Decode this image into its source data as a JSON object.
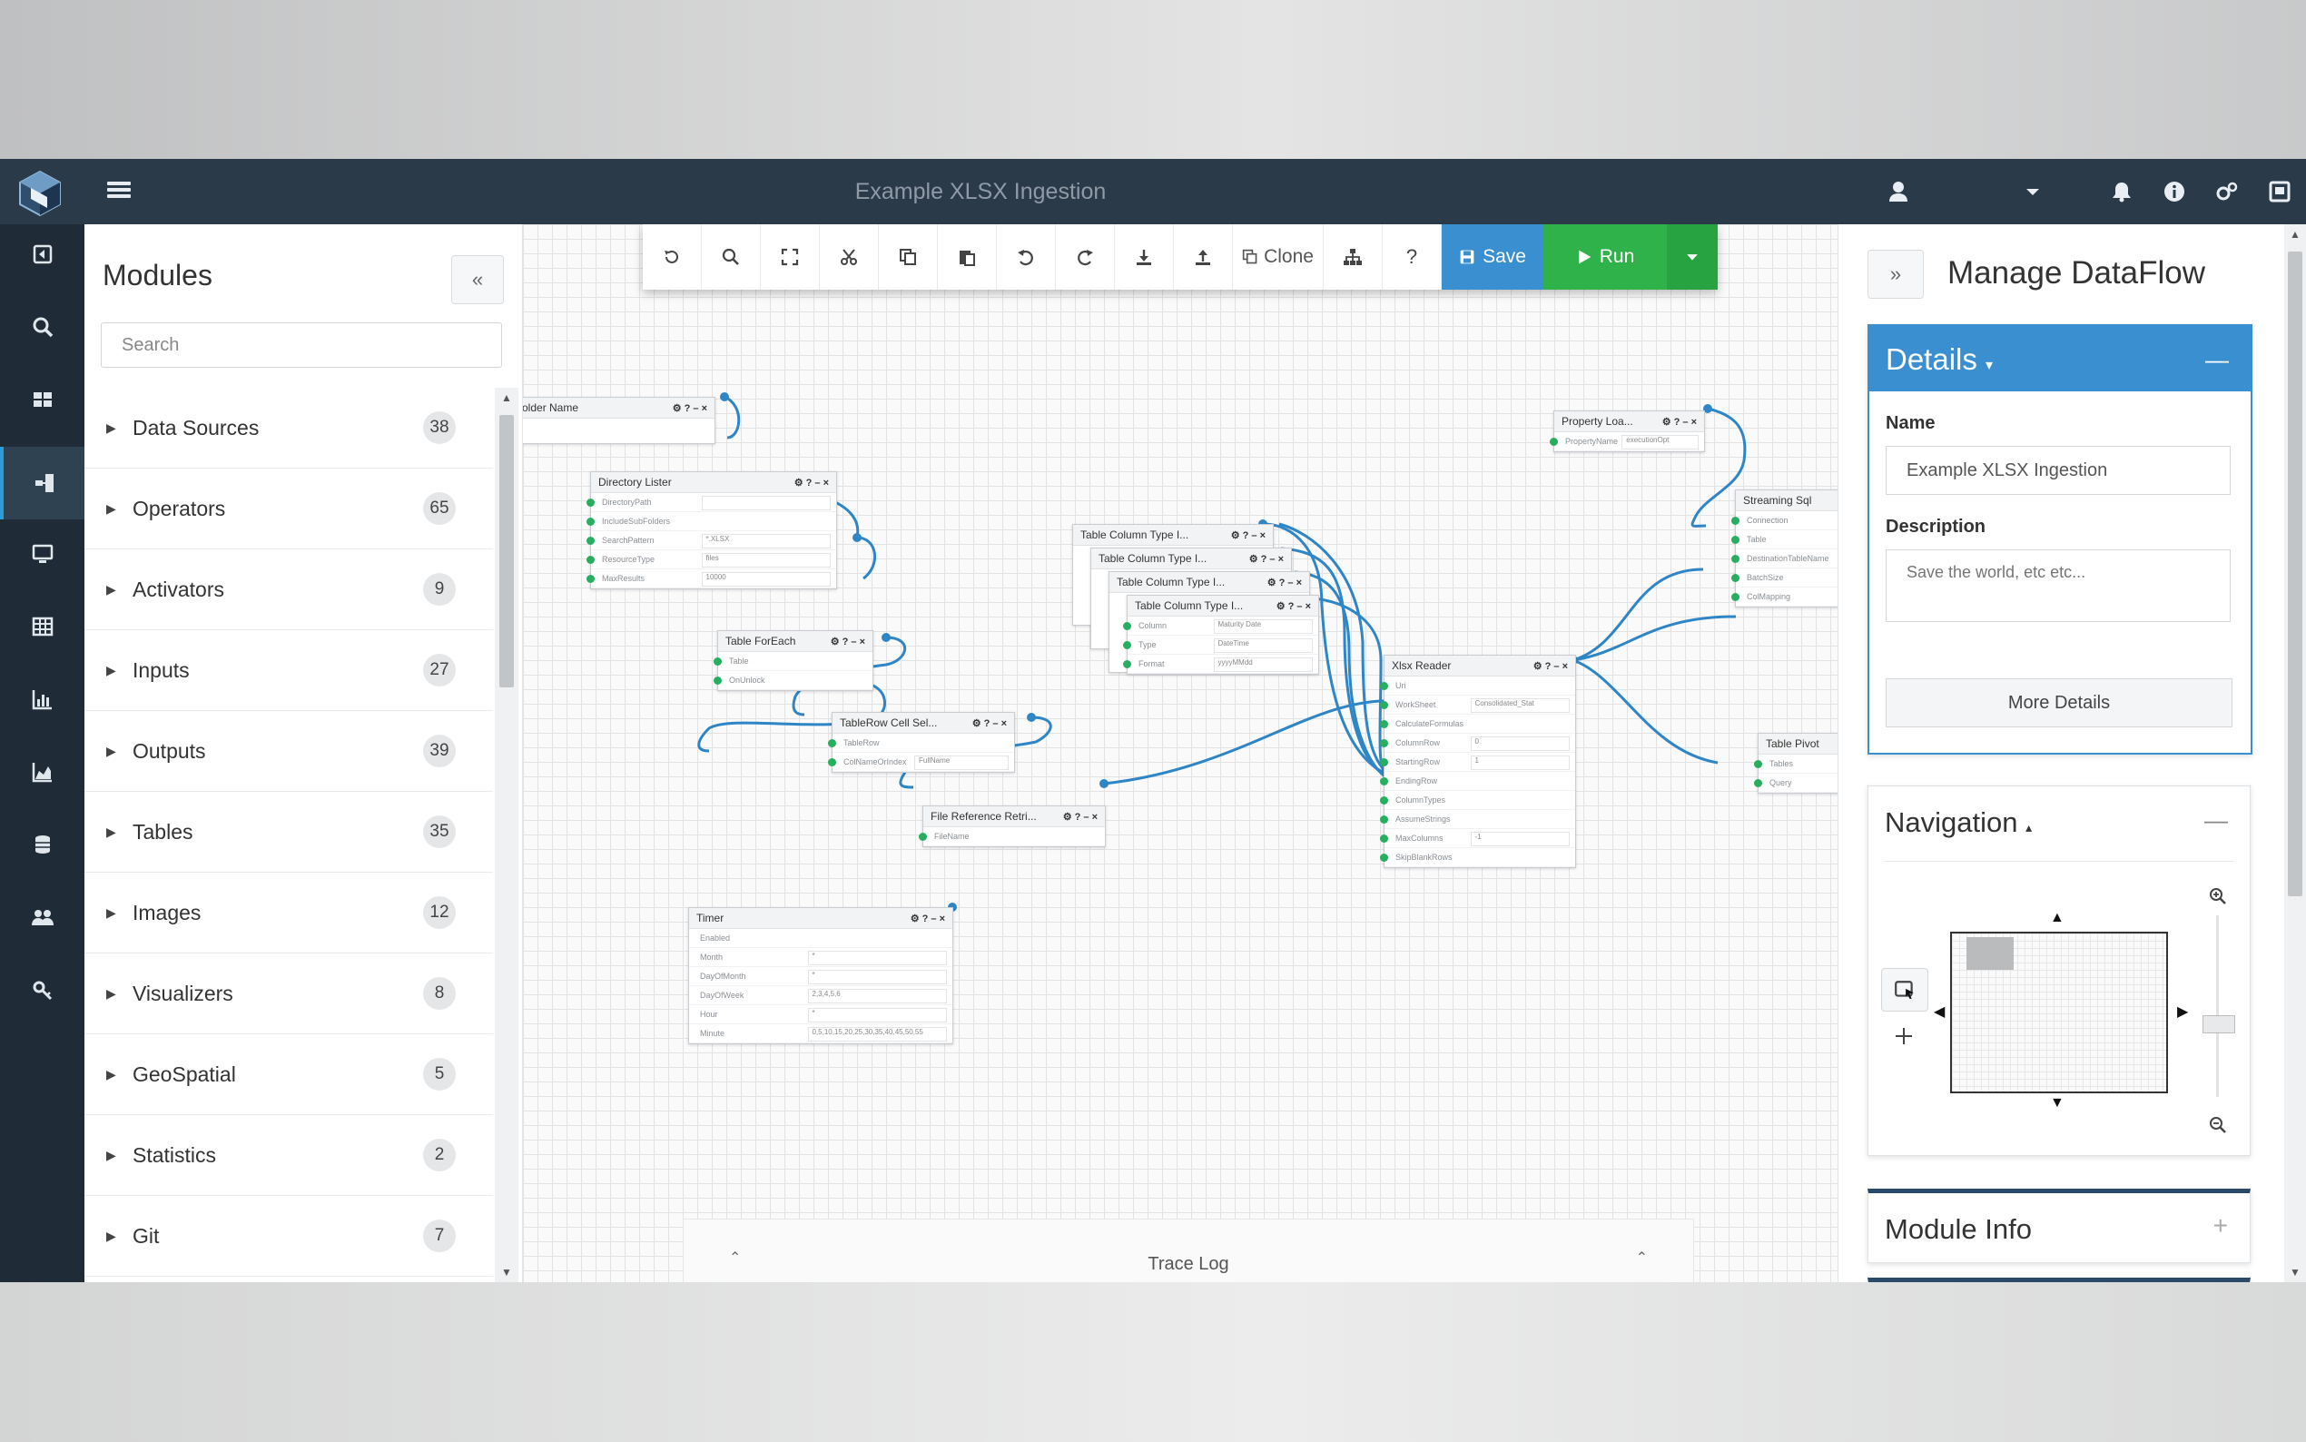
{
  "app": {
    "title": "Example XLSX Ingestion",
    "accent": "#3a8fd1",
    "navbar_color": "#2b3a48",
    "run_color": "#2fb24a"
  },
  "navbar": {
    "icons": [
      "user-icon",
      "caret-down-icon",
      "bell-icon",
      "info-icon",
      "settings-icon",
      "fullscreen-icon"
    ]
  },
  "rail": {
    "items": [
      "import-icon",
      "search-icon",
      "dashboard-icon",
      "dataflow-icon",
      "monitor-icon",
      "grid-icon",
      "bar-chart-icon",
      "area-chart-icon",
      "database-icon",
      "users-icon",
      "key-icon"
    ],
    "active": "dataflow-icon"
  },
  "modules": {
    "title": "Modules",
    "collapse": "«",
    "search_placeholder": "Search",
    "items": [
      {
        "label": "Data Sources",
        "count": "38"
      },
      {
        "label": "Operators",
        "count": "65"
      },
      {
        "label": "Activators",
        "count": "9"
      },
      {
        "label": "Inputs",
        "count": "27"
      },
      {
        "label": "Outputs",
        "count": "39"
      },
      {
        "label": "Tables",
        "count": "35"
      },
      {
        "label": "Images",
        "count": "12"
      },
      {
        "label": "Visualizers",
        "count": "8"
      },
      {
        "label": "GeoSpatial",
        "count": "5"
      },
      {
        "label": "Statistics",
        "count": "2"
      },
      {
        "label": "Git",
        "count": "7"
      }
    ]
  },
  "toolbar": {
    "clone": "Clone",
    "help": "?",
    "save": "Save",
    "run": "Run"
  },
  "canvas": {
    "nodes": {
      "folder": {
        "title": "older Name",
        "ctl": "⚙ ? – ×"
      },
      "dirlister": {
        "title": "Directory Lister",
        "ctl": "⚙ ? – ×",
        "rows": [
          "DirectoryPath",
          "IncludeSubFolders",
          "SearchPattern",
          "ResourceType",
          "MaxResults"
        ],
        "values": [
          "",
          "",
          "*.XLSX",
          "files",
          "10000"
        ]
      },
      "foreach": {
        "title": "Table ForEach",
        "ctl": "⚙ ? – ×",
        "rows": [
          "Table",
          "OnUnlock"
        ]
      },
      "cellsel": {
        "title": "TableRow Cell Sel...",
        "ctl": "⚙ ? – ×",
        "rows": [
          "TableRow",
          "ColNameOrIndex"
        ],
        "values": [
          "",
          "FullName"
        ]
      },
      "fileref": {
        "title": "File Reference Retri...",
        "ctl": "⚙ ? – ×",
        "rows": [
          "FileName"
        ]
      },
      "timer": {
        "title": "Timer",
        "ctl": "⚙ ? – ×",
        "rows": [
          "Enabled",
          "Month",
          "DayOfMonth",
          "DayOfWeek",
          "Hour",
          "Minute"
        ],
        "values": [
          "",
          "*",
          "*",
          "2,3,4,5,6",
          "*",
          "0,5,10,15,20,25,30,35,40,45,50,55"
        ]
      },
      "tct1": {
        "title": "Table Column Type I...",
        "ctl": "⚙ ? – ×"
      },
      "tct2": {
        "title": "Table Column Type I...",
        "ctl": "⚙ ? – ×"
      },
      "tct3": {
        "title": "Table Column Type I...",
        "ctl": "⚙ ? – ×"
      },
      "tct4": {
        "title": "Table Column Type I...",
        "ctl": "⚙ ? – ×",
        "rows": [
          "Column",
          "Type",
          "Format"
        ],
        "values": [
          "Maturity Date",
          "DateTime",
          "yyyyMMdd"
        ]
      },
      "xlsx": {
        "title": "Xlsx Reader",
        "ctl": "⚙ ? – ×",
        "rows": [
          "Uri",
          "WorkSheet",
          "CalculateFormulas",
          "ColumnRow",
          "StartingRow",
          "EndingRow",
          "ColumnTypes",
          "AssumeStrings",
          "MaxColumns",
          "SkipBlankRows"
        ],
        "values": [
          "",
          "Consolidated_Stat",
          "",
          "0",
          "1",
          "",
          "",
          "",
          "-1",
          ""
        ]
      },
      "proploader": {
        "title": "Property Loa...",
        "ctl": "⚙ ? – ×",
        "rows": [
          "PropertyName"
        ],
        "values": [
          "executionOpt"
        ]
      },
      "streaming": {
        "title": "Streaming Sql",
        "rows": [
          "Connection",
          "Table",
          "DestinationTableName",
          "BatchSize",
          "ColMapping"
        ]
      },
      "pivot": {
        "title": "Table Pivot",
        "rows": [
          "Tables",
          "Query"
        ]
      }
    },
    "trace_log": "Trace Log"
  },
  "rpanel": {
    "expand": "»",
    "title": "Manage DataFlow",
    "details": {
      "title": "Details",
      "name_label": "Name",
      "name_value": "Example XLSX Ingestion",
      "description_label": "Description",
      "description_placeholder": "Save the world, etc etc...",
      "more": "More Details"
    },
    "navigation": {
      "title": "Navigation"
    },
    "module_info": {
      "title": "Module Info"
    }
  }
}
